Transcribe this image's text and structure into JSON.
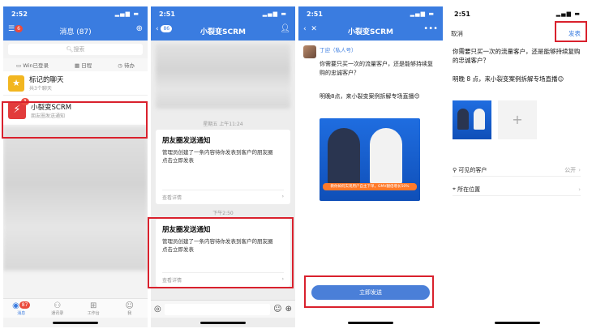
{
  "panel1": {
    "time": "2:52",
    "title": "消息 (87)",
    "menu_badge": "6",
    "search_placeholder": "搜索",
    "quick": [
      "Win已登录",
      "日程",
      "待办"
    ],
    "chats": [
      {
        "name": "标记的聊天",
        "sub": "共3个聊天"
      },
      {
        "name": "小裂变SCRM",
        "sub": "朋友圈发送通知",
        "badge": "1"
      }
    ],
    "tabs": [
      {
        "label": "消息",
        "icon": "chat-icon",
        "badge": "87"
      },
      {
        "label": "通讯录",
        "icon": "contacts-icon"
      },
      {
        "label": "工作台",
        "icon": "workbench-icon"
      },
      {
        "label": "我",
        "icon": "me-icon"
      }
    ]
  },
  "panel2": {
    "time": "2:51",
    "back_count": "86",
    "title": "小裂变SCRM",
    "timestamp1": "星期五 上午11:24",
    "timestamp2": "下午2:50",
    "card": {
      "title": "朋友圈发送通知",
      "body": "管理员创建了一条内容待你发表到客户的朋友圈",
      "action": "点击立即发表",
      "footer": "查看详情"
    }
  },
  "panel3": {
    "time": "2:51",
    "title": "小裂变SCRM",
    "sender": "丁迎（私人号）",
    "message1": "你需要只买一次的流量客户，还是能够持续复购的忠诚客户？",
    "message2": "明晚8点，来小裂变案例拆解专场直播😊",
    "poster_banner": "教你如何实现用户自主下单，GMV翻倍增长50%",
    "send_button": "立即发送"
  },
  "panel4": {
    "time": "2:51",
    "cancel": "取消",
    "publish": "发表",
    "text1": "你需要只买一次的流量客户，还是能够持续复购的忠诚客户？",
    "text2": "明晚 8 点，来小裂变案例拆解专场直播😊",
    "rows": [
      {
        "label": "可见的客户",
        "value": "公开",
        "icon": "user-icon"
      },
      {
        "label": "所在位置",
        "value": "",
        "icon": "location-icon"
      }
    ],
    "add_symbol": "+"
  },
  "colors": {
    "brand_blue": "#3a7ce0",
    "highlight_red": "#d9212d",
    "send_blue": "#4a7fd8"
  }
}
